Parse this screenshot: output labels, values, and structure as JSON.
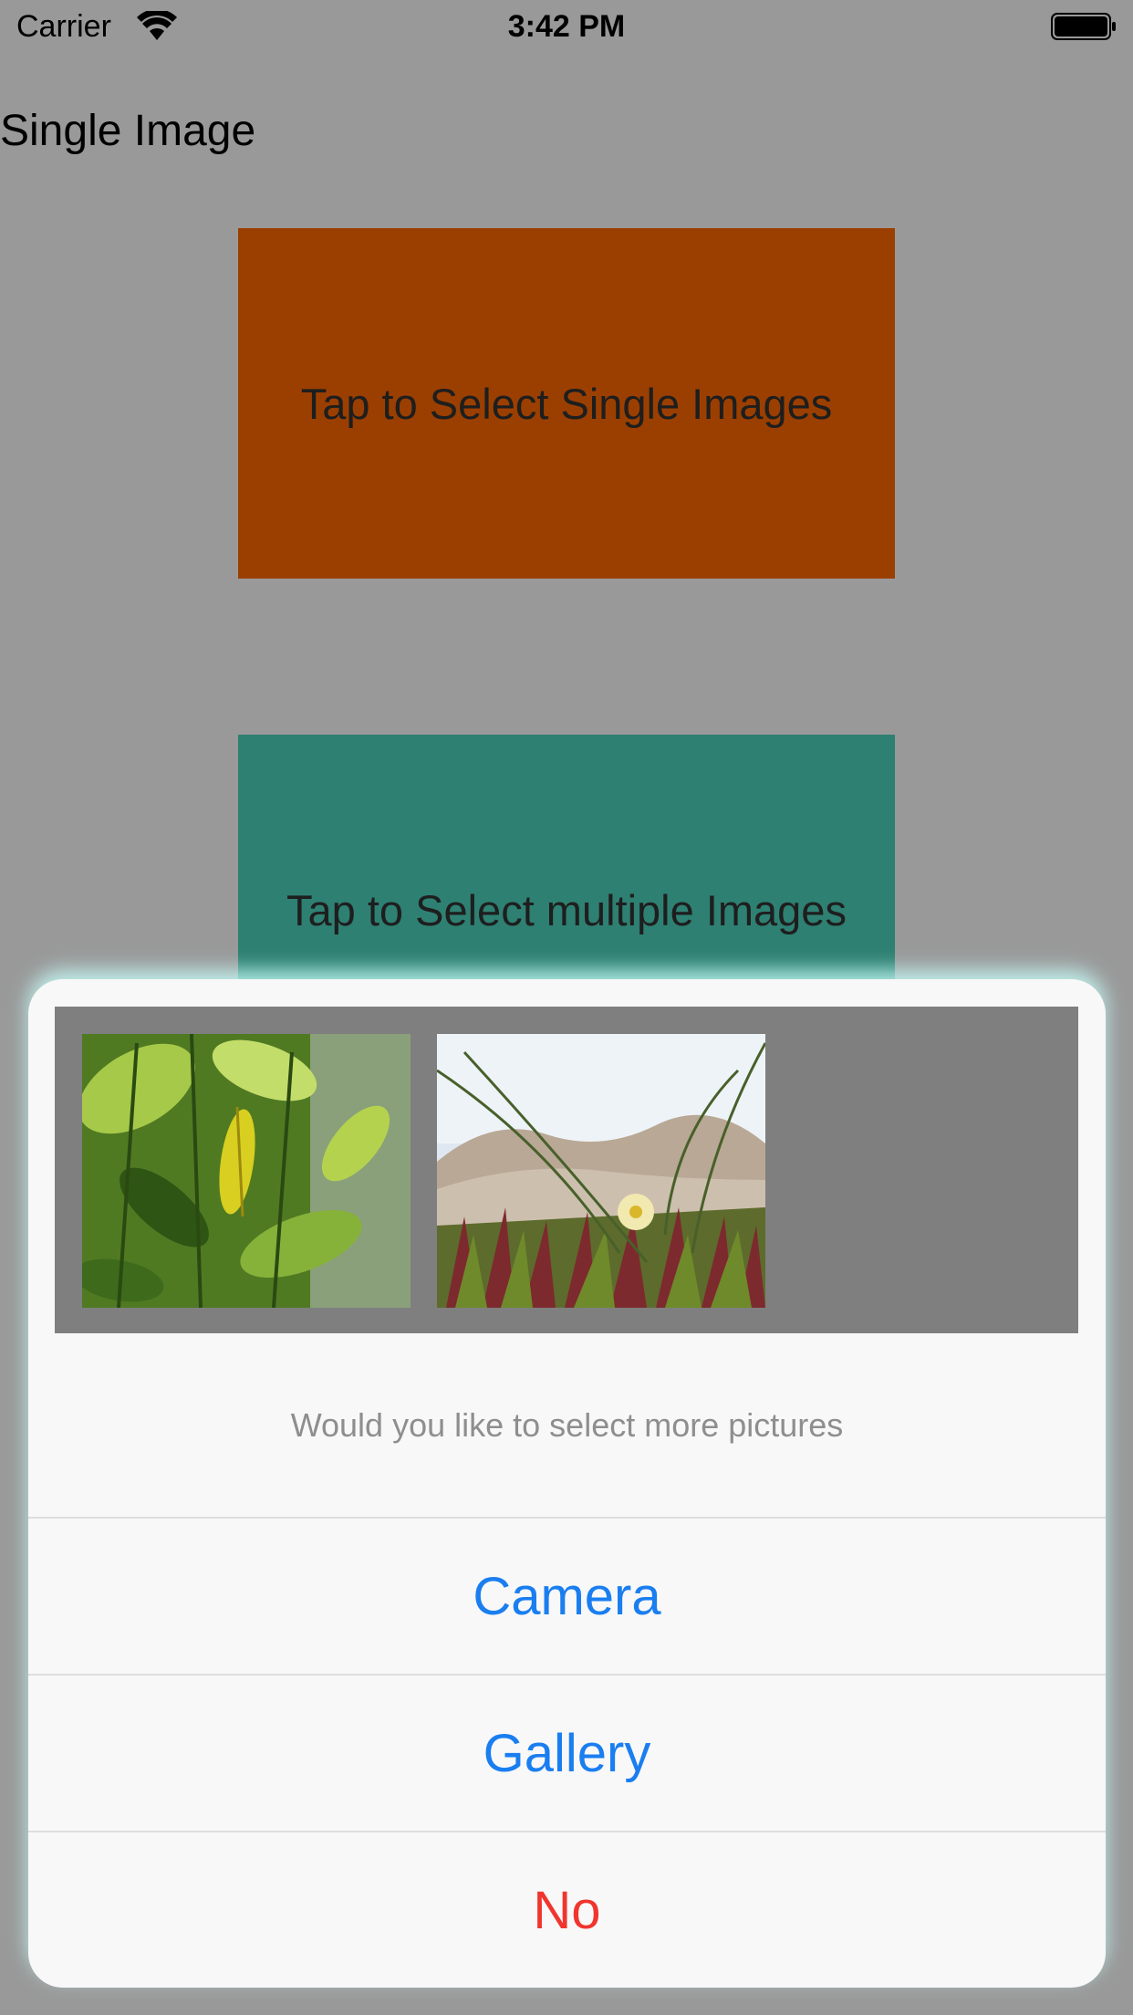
{
  "status_bar": {
    "carrier": "Carrier",
    "time": "3:42 PM",
    "wifi_icon": "wifi-icon",
    "battery_icon": "battery-icon"
  },
  "page": {
    "title": "Single Image"
  },
  "buttons": {
    "single": {
      "label": "Tap to Select Single Images",
      "color": "#9b3f00"
    },
    "multiple": {
      "label": "Tap to Select multiple Images",
      "color": "#2e8072"
    }
  },
  "action_sheet": {
    "preview_images": [
      {
        "name": "leaves-photo"
      },
      {
        "name": "dune-flower-photo"
      }
    ],
    "message": "Would you like  to select more pictures",
    "actions": {
      "camera": "Camera",
      "gallery": "Gallery",
      "no": "No"
    },
    "colors": {
      "default_action": "#1a7ef0",
      "destructive_action": "#f0352f"
    }
  }
}
